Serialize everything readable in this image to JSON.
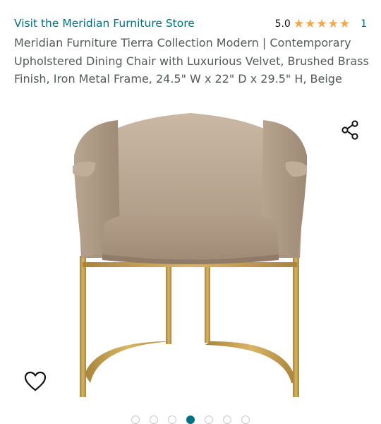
{
  "store_link": "Visit the Meridian Furniture Store",
  "rating": {
    "score_text": "5.0",
    "stars": 5,
    "count": "1",
    "star_color": "#f3a847"
  },
  "title": "Meridian Furniture Tierra Collection Modern | Contemporary Upholstered Dining Chair with Luxurious Velvet, Brushed Brass Finish, Iron Metal Frame, 24.5\" W x 22\" D x 29.5\" H, Beige",
  "icons": {
    "share": "share-icon",
    "favorite": "heart-icon"
  },
  "carousel": {
    "total": 7,
    "active_index": 3
  },
  "colors": {
    "link": "#007185",
    "velvet": "#b6a28d",
    "brass": "#c9a24e"
  }
}
